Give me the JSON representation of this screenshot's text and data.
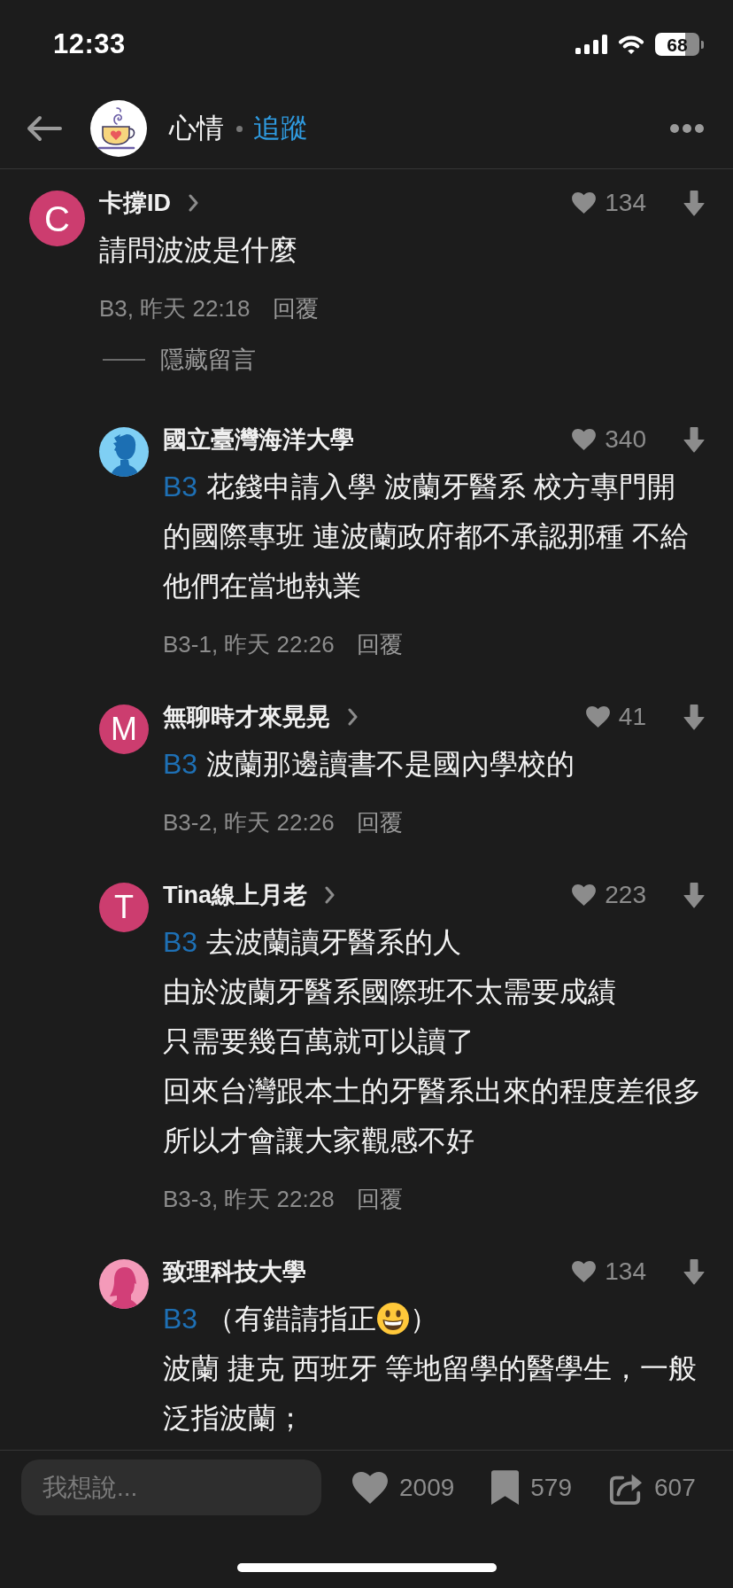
{
  "status_bar": {
    "time": "12:33",
    "battery": "68"
  },
  "header": {
    "board": "心情",
    "follow": "追蹤"
  },
  "comments": [
    {
      "author": "卡撐ID",
      "profile_link": true,
      "avatar": {
        "kind": "letter",
        "letter": "C"
      },
      "likes": "134",
      "lines": [
        [
          {
            "kind": "text",
            "text": "請問波波是什麼"
          }
        ]
      ],
      "meta": "B3, 昨天 22:18",
      "reply": "回覆",
      "hide_replies": "隱藏留言",
      "children": [
        {
          "author": "國立臺灣海洋大學",
          "profile_link": false,
          "avatar": {
            "kind": "male"
          },
          "likes": "340",
          "reply_to": "B3",
          "lines": [
            [
              {
                "kind": "text",
                "text": "花錢申請入學 波蘭牙醫系 校方專門開"
              }
            ],
            [
              {
                "kind": "text",
                "text": "的國際專班 連波蘭政府都不承認那種 不給"
              }
            ],
            [
              {
                "kind": "text",
                "text": "他們在當地執業"
              }
            ]
          ],
          "meta": "B3-1, 昨天 22:26",
          "reply": "回覆"
        },
        {
          "author": "無聊時才來晃晃",
          "profile_link": true,
          "avatar": {
            "kind": "letter",
            "letter": "M"
          },
          "likes": "41",
          "reply_to": "B3",
          "lines": [
            [
              {
                "kind": "text",
                "text": "波蘭那邊讀書不是國內學校的"
              }
            ]
          ],
          "meta": "B3-2, 昨天 22:26",
          "reply": "回覆"
        },
        {
          "author": "Tina線上月老",
          "profile_link": true,
          "avatar": {
            "kind": "letter",
            "letter": "T"
          },
          "likes": "223",
          "reply_to": "B3",
          "lines": [
            [
              {
                "kind": "text",
                "text": "去波蘭讀牙醫系的人"
              }
            ],
            [
              {
                "kind": "text",
                "text": "由於波蘭牙醫系國際班不太需要成績"
              }
            ],
            [
              {
                "kind": "text",
                "text": "只需要幾百萬就可以讀了"
              }
            ],
            [
              {
                "kind": "text",
                "text": "回來台灣跟本土的牙醫系出來的程度差很多"
              }
            ],
            [
              {
                "kind": "text",
                "text": "所以才會讓大家觀感不好"
              }
            ]
          ],
          "meta": "B3-3, 昨天 22:28",
          "reply": "回覆"
        },
        {
          "author": "致理科技大學",
          "profile_link": false,
          "avatar": {
            "kind": "female"
          },
          "likes": "134",
          "reply_to": "B3",
          "lines": [
            [
              {
                "kind": "text",
                "text": "（有錯請指正"
              },
              {
                "kind": "emoji"
              },
              {
                "kind": "text",
                "text": "）"
              }
            ],
            [
              {
                "kind": "text",
                "text": "波蘭 捷克 西班牙 等地留學的醫學生，一般"
              }
            ],
            [
              {
                "kind": "text",
                "text": "泛指波蘭；"
              }
            ]
          ]
        }
      ]
    }
  ],
  "composer": {
    "placeholder": "我想說..."
  },
  "actions": [
    {
      "kind": "like",
      "count": "2009"
    },
    {
      "kind": "bookmark",
      "count": "579"
    },
    {
      "kind": "share",
      "count": "607"
    }
  ]
}
